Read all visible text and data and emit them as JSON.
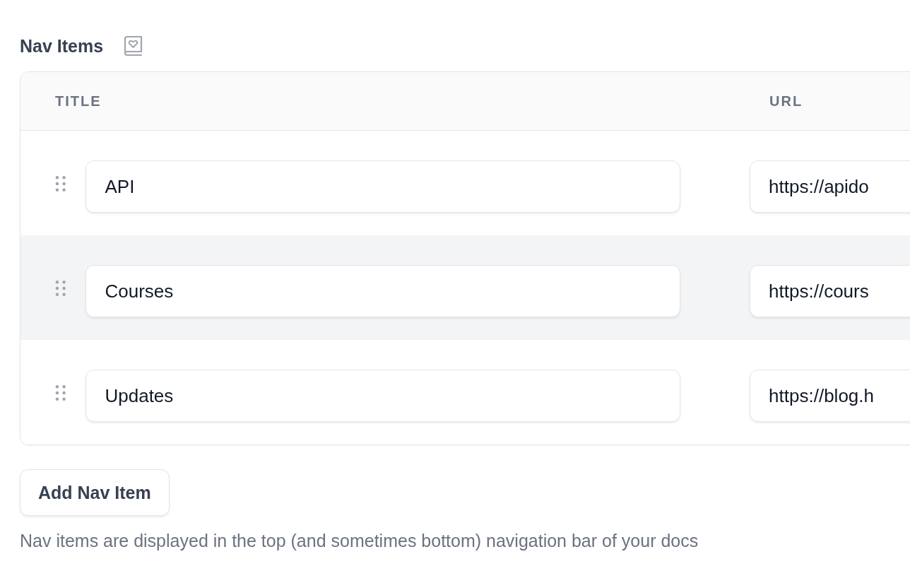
{
  "section": {
    "title": "Nav Items"
  },
  "table": {
    "columns": [
      "TITLE",
      "URL"
    ],
    "rows": [
      {
        "title": "API",
        "url": "https://apido",
        "hovered": false
      },
      {
        "title": "Courses",
        "url": "https://cours",
        "hovered": true
      },
      {
        "title": "Updates",
        "url": "https://blog.h",
        "hovered": false
      }
    ]
  },
  "add_button": "Add Nav Item",
  "help_text": "Nav items are displayed in the top (and sometimes bottom) navigation bar of your docs"
}
